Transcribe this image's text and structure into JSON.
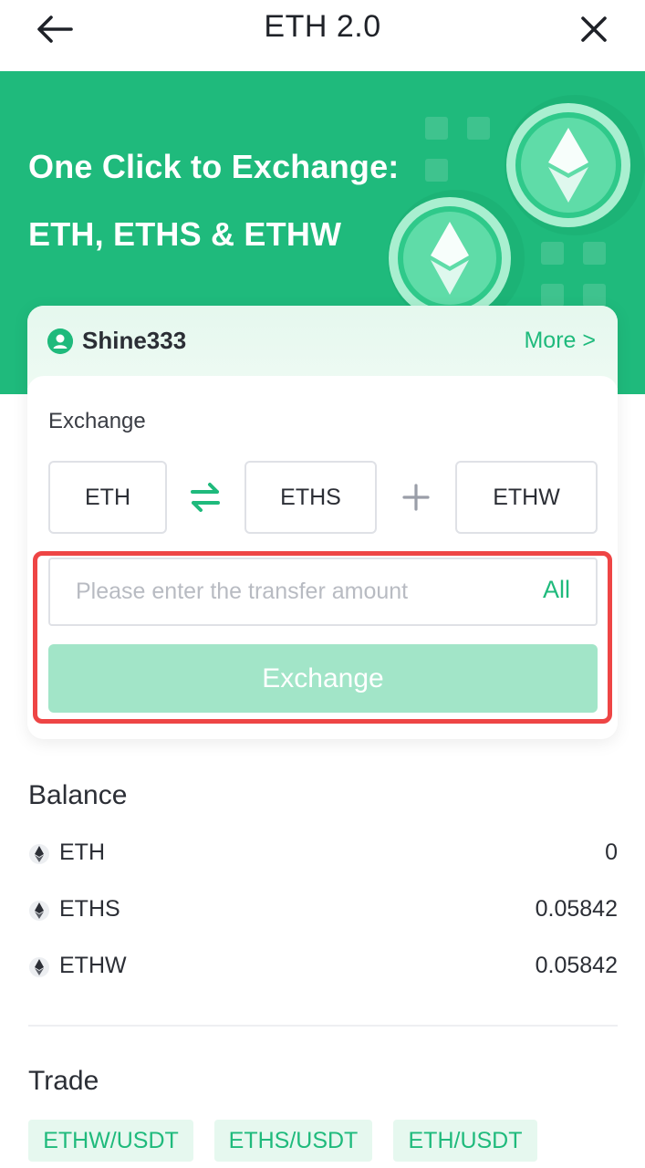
{
  "header": {
    "title": "ETH 2.0"
  },
  "banner": {
    "line1": "One Click to Exchange:",
    "line2": "ETH, ETHS & ETHW"
  },
  "account": {
    "username": "Shine333",
    "more_label": "More >"
  },
  "exchange": {
    "label": "Exchange",
    "from_token": "ETH",
    "to_token_1": "ETHS",
    "to_token_2": "ETHW",
    "amount_value": "",
    "amount_placeholder": "Please enter the transfer amount",
    "all_label": "All",
    "button_label": "Exchange",
    "button_state": "disabled"
  },
  "balance": {
    "title": "Balance",
    "items": [
      {
        "coin": "ETH",
        "value": "0"
      },
      {
        "coin": "ETHS",
        "value": "0.05842"
      },
      {
        "coin": "ETHW",
        "value": "0.05842"
      }
    ]
  },
  "trade": {
    "title": "Trade",
    "pairs": [
      "ETHW/USDT",
      "ETHS/USDT",
      "ETH/USDT"
    ]
  },
  "colors": {
    "brand_green": "#1fba7c",
    "disabled_button": "#a2e5c8",
    "highlight_frame": "#ee4545",
    "chip_background": "#e6f8ef"
  },
  "icons": {
    "back": "arrow-left-icon",
    "close": "close-icon",
    "user": "user-icon",
    "swap": "swap-arrows-icon",
    "plus": "plus-icon",
    "coin": "ethereum-icon",
    "banner_coins": "ethereum-coin-illustration"
  }
}
